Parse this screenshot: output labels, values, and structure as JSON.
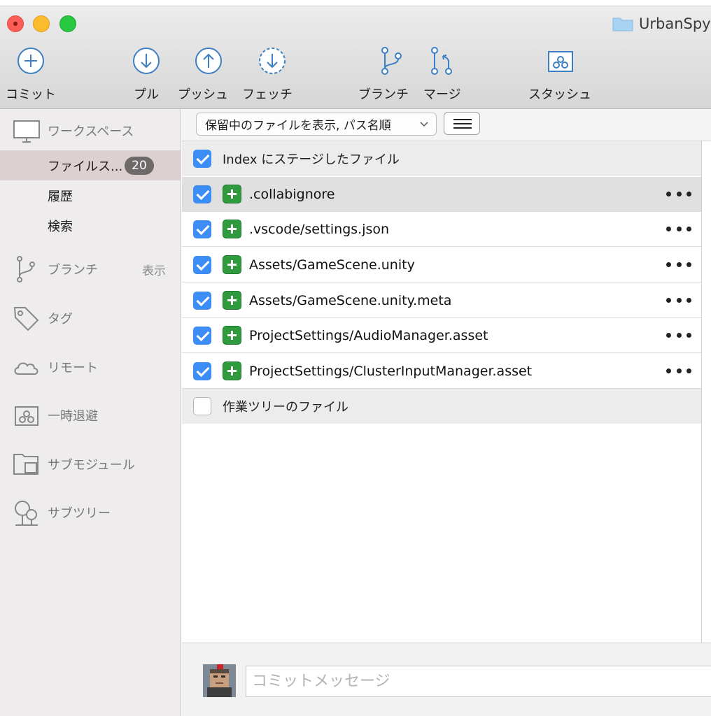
{
  "window": {
    "title": "UrbanSpy",
    "folder_icon": "folder-icon"
  },
  "toolbar": {
    "commit": "コミット",
    "pull": "プル",
    "push": "プッシュ",
    "fetch": "フェッチ",
    "branch": "ブランチ",
    "merge": "マージ",
    "stash": "スタッシュ"
  },
  "sidebar": {
    "workspace": "ワークスペース",
    "file_status": "ファイルス...",
    "file_status_count": "20",
    "history": "履歴",
    "search": "検索",
    "branches": "ブランチ",
    "branches_show": "表示",
    "tags": "タグ",
    "remotes": "リモート",
    "stashes": "一時退避",
    "submodules": "サブモジュール",
    "subtrees": "サブツリー"
  },
  "filter": {
    "dropdown_label": "保留中のファイルを表示, パス名順"
  },
  "staged": {
    "header": "Index にステージしたファイル",
    "files": [
      ".collabignore",
      ".vscode/settings.json",
      "Assets/GameScene.unity",
      "Assets/GameScene.unity.meta",
      "ProjectSettings/AudioManager.asset",
      "ProjectSettings/ClusterInputManager.asset"
    ]
  },
  "unstaged": {
    "header": "作業ツリーのファイル"
  },
  "commit": {
    "placeholder": "コミットメッセージ"
  },
  "colors": {
    "accent_blue": "#3c8df6",
    "added_green": "#2f9a3e",
    "sidebar_selected": "#dcd1d0",
    "icon_blue": "#3d7fc2"
  }
}
